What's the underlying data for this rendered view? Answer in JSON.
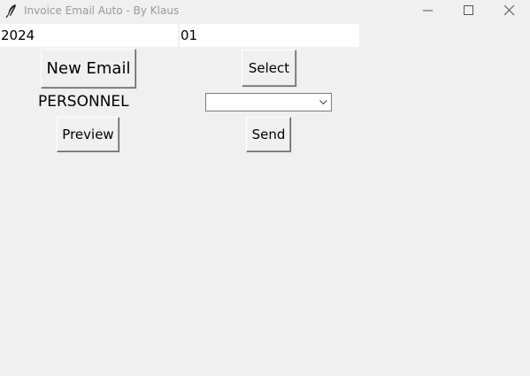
{
  "window": {
    "title": "Invoice Email Auto - By Klaus",
    "icon": "feather-icon",
    "controls": [
      "minimize-icon",
      "maximize-icon",
      "close-icon"
    ]
  },
  "fields": {
    "year_value": "2024",
    "month_value": "01"
  },
  "buttons": {
    "new_email": "New Email",
    "select": "Select",
    "preview": "Preview",
    "send": "Send"
  },
  "personnel": {
    "label": "PERSONNEL",
    "selected": ""
  },
  "colors": {
    "window_bg": "#f0f0f0",
    "entry_bg": "#ffffff",
    "title_text": "#9a9a9a"
  }
}
